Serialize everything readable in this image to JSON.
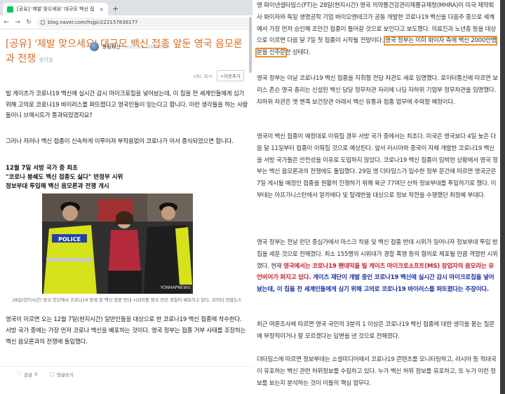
{
  "browser": {
    "tab_title": "[공유] '제발 맞으세요' 대규모 백신 접",
    "tab_close": "×",
    "new_tab": "+",
    "url": "blog.naver.com/hsjpi/222157838177"
  },
  "post": {
    "title": "[공유] '제발 맞으세요' 대규모 백신 접종 앞둔 영국 음모론과 전쟁",
    "author_label": "생각글",
    "blogger": "동림화산",
    "date": "2020. 11. 28. 20:20",
    "url_copy": "URL 복사",
    "add_neighbor": "+이웃추가",
    "para1": "빌 게이츠가 코로나19 백신에 실시간 감시 마이크로칩을 넣어놨는데, 이 칩을 전 세계인들에게 심기 위해 고의로 코로나19 바이러스를 퍼뜨렸다고 영국인들이 믿는다고 합니다. 이런 생각들을 하는 사람들이니 브렉시트가 통과되었겠지요?",
    "para2": "그러나 저러나 백신 접종이 신속하게 이루어져 부작용없이 코로나가 어서 종식되었으면 합니다.",
    "headline1": "12월 7일 서방 국가 중 최초",
    "headline2": "\"코로나 봉쇄도 백신 접종도 싫다\" 반정부 시위",
    "headline3": "정보부대 투입해 백신 음모론과 전쟁 개시",
    "photo_police_label": "POLICE",
    "photo_watermark": "YONHAPNEWS",
    "photo_caption": "28일(현지시간) 영국 런던에서 코로나19 봉쇄 및 백신 접종 반대 시위자를 영국 런던 경찰이 체포하고 있다. 로이터 연합뉴스",
    "para3": "영국이 이르면 오는 12월 7일(현지시간) 일반인들을 대상으로 한 코로나19 백신 접종에 착수한다. 서방 국가 중에는 가장 먼저 코로나 백신을 배포하는 것이다. 영국 정부는 접종 거부 사태를 조장하는 백신 음모론과의 전쟁에 돌입했다.",
    "like_label": "공감",
    "like_count": "0",
    "comment_label": "댓글쓰기"
  },
  "article": {
    "r1_before": "영 파이낸셜타임스(FT)는 28일(현지시간) 영국 의약품건강관리제품규제청(MHRA)이 미국 제약회사 화이자와 독일 생명공학 기업 바이오엔테크가 공동 개발한 코로나19 백신을 다음주 중으로 세계에서 가장 먼저 승인해 조만간 접종이 들어갈 것으로 보인다고 보도했다. 의료진과 노년층 등을 대상으로 이르면 다음 달 7일 첫 접종이 시작될 전망이다. ",
    "r1_highlight": "영국 정부는 이미 화이자 측에 백신 2000만명분을 선주문",
    "r1_after": "한 상태다.",
    "r2": "영국 정부는 이날 코로나19 백신 접종을 지휘할 전담 차관도 새로 임명했다. 로이터통신에 따르면 보리스 존슨 영국 총리는 신설된 백신 담당 정무차관 자리에 나딤 자하위 기업부 정무차관을 임명했다. 자하위 차관은 맷 핸콕 보건장관 아래서 백신 유통과 접종 업무에 주력할 예정이다.",
    "r3": "영국이 백신 접종이 예정대로 이뤄질 경우 서방 국가 중에서는 최초다. 미국은 영국보다 4일 늦은 다음 달 11일부터 접종이 이뤄질 것으로 예상된다. 앞서 러시아와 중국이 자체 개발한 코로나19 백신을 서방 국가들은 안전성을 이유로 도입하지 않았다. 코로나19 백신 접종이 임박한 상황에서 영국 정부는 백신 음모론과의 전쟁에도 돌입했다. 29일 영 더타임스가 입수한 정부 문건에 따르면 영국군은 7일 게시될 예정인 접종을 원활히 진행하기 위해 육군 77여단 산하 정보부대를 투입하기로 했다. 이 부대는 아프가니스탄에서 알카에다 및 탈레반을 대상으로 정보 작전을 수행했던 최정예 부대다.",
    "r4_before": "영국 정부는 전날 런던 중심가에서 마스크 착용 및 백신 접종 반대 시위가 일어나자 정보부대 투입 방침을 세운 것으로 전해졌다. 최소 155명의 시위대가 경찰 폭행 등의 혐의로 체포될 만큼 격렬한 시위였다. 현재 ",
    "r4_red": "영국에서는 코로나19 팬데믹을 빌 게이츠 마이크로소프트(MS) 창업자의 음모라는 유언비어가 퍼지고 있다.",
    "r4_blue": " 게이츠 재단이 개발 중인 코로나19 백신에 실시간 감시 마이크로칩을 넣어놨는데, 이 칩을 전 세계인들에게 심기 위해 고의로 코로나19 바이러스를 퍼뜨렸다는 주장이다.",
    "r5": "최근 여론조사에 따르면 영국 국민의 3분의 1 이상은 코로나19 백신 접종에 대한 생각을 묻는 질문에 부정적이거나 잘 모르겠다는 답변을 낸 것으로 전해졌다.",
    "r6": "더타임스에 따르면 정보부대는 소셜미디어에서 코로나19 콘텐츠를 모니터링하고, 러시아 등 적대국이 유포하는 백신 관련 허위정보를 수집하고 있다. 누가 백신 허위 정보를 유포하고, 또 누가 이런 정보를 보는지 분석하는 것이 이들의 핵심 업무다."
  },
  "colors": {
    "title_orange": "#d56d1f",
    "highlight_box": "#e6952f",
    "emphasis_red": "#c4202c",
    "emphasis_blue": "#1a2fa0",
    "naver_green": "#03c75a"
  },
  "icons": [
    "naver-favicon",
    "back-arrow-icon",
    "forward-arrow-icon",
    "reload-icon",
    "lock-icon",
    "heart-icon",
    "comment-icon"
  ]
}
